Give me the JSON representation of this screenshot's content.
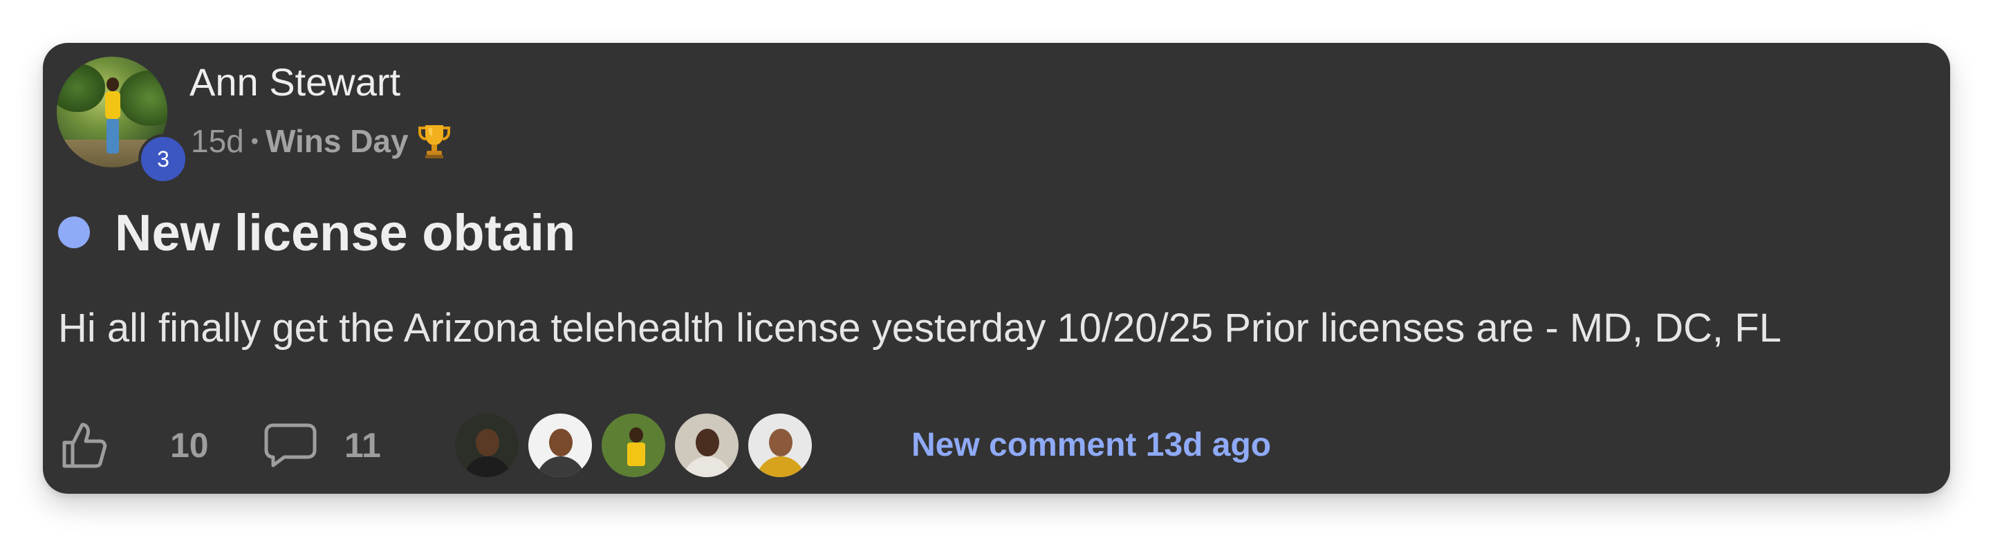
{
  "post": {
    "author": "Ann Stewart",
    "level": "3",
    "age": "15d",
    "separator": "•",
    "category": "Wins Day",
    "title": "New license obtain",
    "body": "Hi all finally get the Arizona telehealth license yesterday 10/20/25 Prior licenses are - MD, DC, FL",
    "likes": "10",
    "comments": "11",
    "new_comment": "New comment 13d ago"
  },
  "icons": {
    "category": "trophy-icon",
    "like": "thumbs-up-icon",
    "comment": "comment-bubble-icon"
  },
  "colors": {
    "card_background": "#333333",
    "accent": "#8faaf7",
    "level_badge": "#3c57c2",
    "muted_text": "#9e9e9e"
  }
}
